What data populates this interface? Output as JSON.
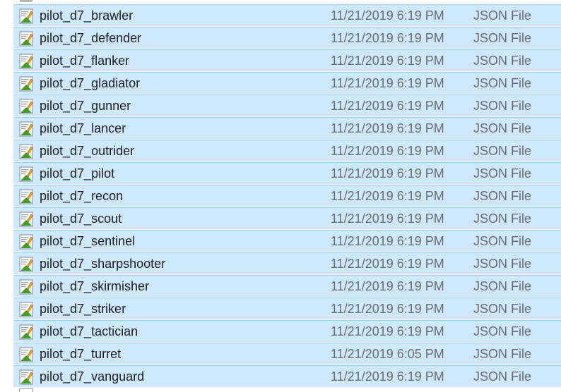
{
  "colors": {
    "selection_bg": "#cde8ff",
    "selection_border": "#99d1ff",
    "meta_text": "#6d6d6d",
    "icon_green": "#3aa12a"
  },
  "file_icon": "json-file-icon",
  "files": [
    {
      "name": "pilot_d7_brawler",
      "date": "11/21/2019 6:19 PM",
      "type": "JSON File"
    },
    {
      "name": "pilot_d7_defender",
      "date": "11/21/2019 6:19 PM",
      "type": "JSON File"
    },
    {
      "name": "pilot_d7_flanker",
      "date": "11/21/2019 6:19 PM",
      "type": "JSON File"
    },
    {
      "name": "pilot_d7_gladiator",
      "date": "11/21/2019 6:19 PM",
      "type": "JSON File"
    },
    {
      "name": "pilot_d7_gunner",
      "date": "11/21/2019 6:19 PM",
      "type": "JSON File"
    },
    {
      "name": "pilot_d7_lancer",
      "date": "11/21/2019 6:19 PM",
      "type": "JSON File"
    },
    {
      "name": "pilot_d7_outrider",
      "date": "11/21/2019 6:19 PM",
      "type": "JSON File"
    },
    {
      "name": "pilot_d7_pilot",
      "date": "11/21/2019 6:19 PM",
      "type": "JSON File"
    },
    {
      "name": "pilot_d7_recon",
      "date": "11/21/2019 6:19 PM",
      "type": "JSON File"
    },
    {
      "name": "pilot_d7_scout",
      "date": "11/21/2019 6:19 PM",
      "type": "JSON File"
    },
    {
      "name": "pilot_d7_sentinel",
      "date": "11/21/2019 6:19 PM",
      "type": "JSON File"
    },
    {
      "name": "pilot_d7_sharpshooter",
      "date": "11/21/2019 6:19 PM",
      "type": "JSON File"
    },
    {
      "name": "pilot_d7_skirmisher",
      "date": "11/21/2019 6:19 PM",
      "type": "JSON File"
    },
    {
      "name": "pilot_d7_striker",
      "date": "11/21/2019 6:19 PM",
      "type": "JSON File"
    },
    {
      "name": "pilot_d7_tactician",
      "date": "11/21/2019 6:19 PM",
      "type": "JSON File"
    },
    {
      "name": "pilot_d7_turret",
      "date": "11/21/2019 6:05 PM",
      "type": "JSON File"
    },
    {
      "name": "pilot_d7_vanguard",
      "date": "11/21/2019 6:19 PM",
      "type": "JSON File"
    }
  ]
}
